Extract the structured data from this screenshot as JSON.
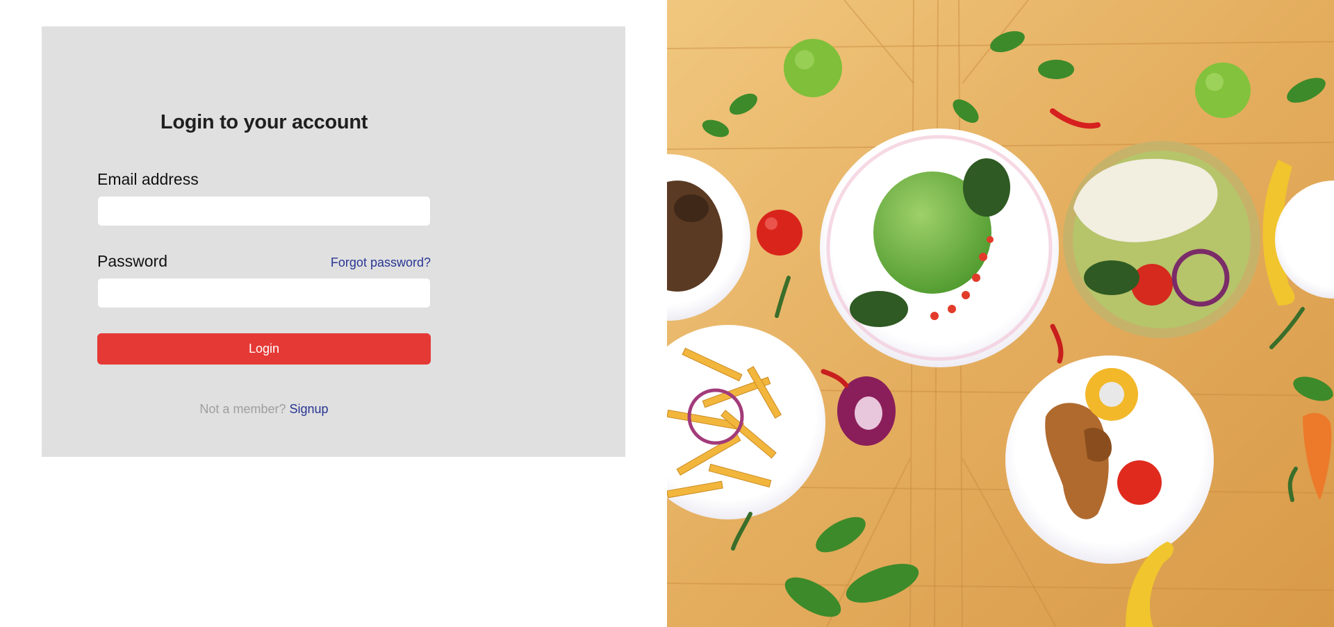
{
  "login": {
    "title": "Login to your account",
    "email_label": "Email address",
    "email_value": "",
    "password_label": "Password",
    "password_value": "",
    "forgot_password": "Forgot password?",
    "submit_label": "Login",
    "signup_prompt": "Not a member?",
    "signup_link": "Signup"
  },
  "colors": {
    "card_background": "#e0e0e0",
    "accent_red": "#e53935",
    "link_blue": "#283593",
    "muted_text": "#9e9e9e"
  },
  "hero_image": {
    "icon": "food-photo"
  }
}
